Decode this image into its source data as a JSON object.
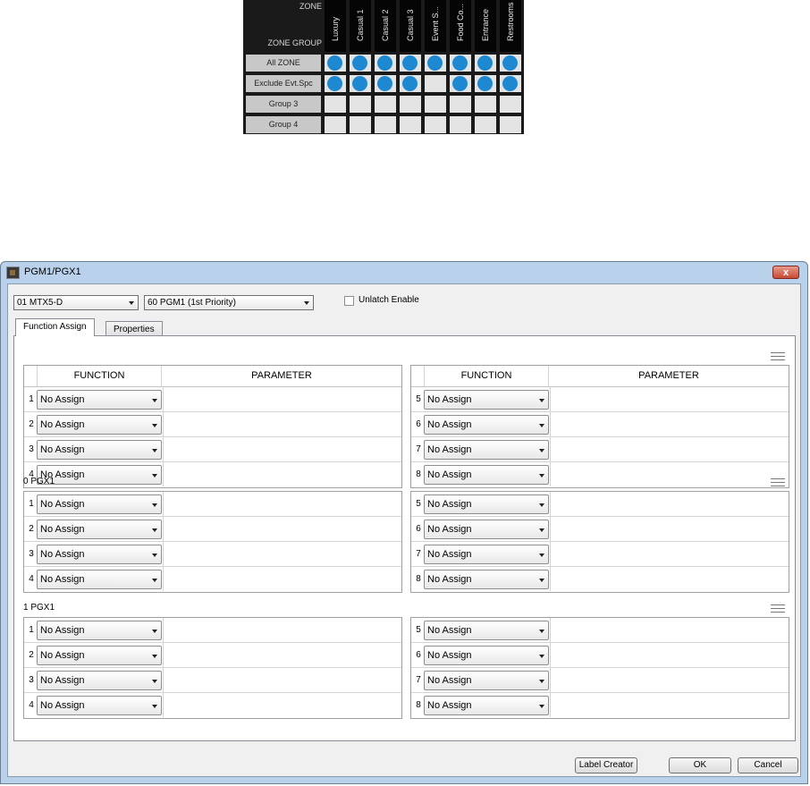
{
  "zone_matrix": {
    "zone_label": "ZONE",
    "group_label": "ZONE GROUP",
    "zones": [
      "Luxury",
      "Casual 1",
      "Casual 2",
      "Casual 3",
      "Event S...",
      "Food Co...",
      "Entrance",
      "Restrooms"
    ],
    "groups": [
      {
        "label": "All ZONE",
        "assigned": [
          true,
          true,
          true,
          true,
          true,
          true,
          true,
          true
        ]
      },
      {
        "label": "Exclude Evt.Spc",
        "assigned": [
          true,
          true,
          true,
          true,
          false,
          true,
          true,
          true
        ]
      },
      {
        "label": "Group 3",
        "assigned": [
          false,
          false,
          false,
          false,
          false,
          false,
          false,
          false
        ]
      },
      {
        "label": "Group 4",
        "assigned": [
          false,
          false,
          false,
          false,
          false,
          false,
          false,
          false
        ]
      }
    ],
    "colors": {
      "assigned": "#1e88d0",
      "empty": "#e4e4e4"
    }
  },
  "dialog": {
    "title": "PGM1/PGX1",
    "close_label": "x",
    "device_select": "01 MTX5-D",
    "input_select": "60 PGM1 (1st Priority)",
    "unlatch_label": "Unlatch Enable",
    "unlatch_checked": false,
    "tabs": [
      "Function Assign",
      "Properties"
    ],
    "function_header": "FUNCTION",
    "parameter_header": "PARAMETER",
    "sections": [
      {
        "title": "",
        "rows": [
          {
            "num": "1",
            "value": "No Assign"
          },
          {
            "num": "2",
            "value": "No Assign"
          },
          {
            "num": "3",
            "value": "No Assign"
          },
          {
            "num": "4",
            "value": "No Assign"
          },
          {
            "num": "5",
            "value": "No Assign"
          },
          {
            "num": "6",
            "value": "No Assign"
          },
          {
            "num": "7",
            "value": "No Assign"
          },
          {
            "num": "8",
            "value": "No Assign"
          }
        ]
      },
      {
        "title": "0 PGX1",
        "rows": [
          {
            "num": "1",
            "value": "No Assign"
          },
          {
            "num": "2",
            "value": "No Assign"
          },
          {
            "num": "3",
            "value": "No Assign"
          },
          {
            "num": "4",
            "value": "No Assign"
          },
          {
            "num": "5",
            "value": "No Assign"
          },
          {
            "num": "6",
            "value": "No Assign"
          },
          {
            "num": "7",
            "value": "No Assign"
          },
          {
            "num": "8",
            "value": "No Assign"
          }
        ]
      },
      {
        "title": "1 PGX1",
        "rows": [
          {
            "num": "1",
            "value": "No Assign"
          },
          {
            "num": "2",
            "value": "No Assign"
          },
          {
            "num": "3",
            "value": "No Assign"
          },
          {
            "num": "4",
            "value": "No Assign"
          },
          {
            "num": "5",
            "value": "No Assign"
          },
          {
            "num": "6",
            "value": "No Assign"
          },
          {
            "num": "7",
            "value": "No Assign"
          },
          {
            "num": "8",
            "value": "No Assign"
          }
        ]
      }
    ],
    "buttons": {
      "label_creator": "Label Creator",
      "ok": "OK",
      "cancel": "Cancel"
    },
    "icons": {
      "section_menu": "hamburger-menu-icon",
      "app": "app-icon",
      "close": "close-icon"
    }
  }
}
